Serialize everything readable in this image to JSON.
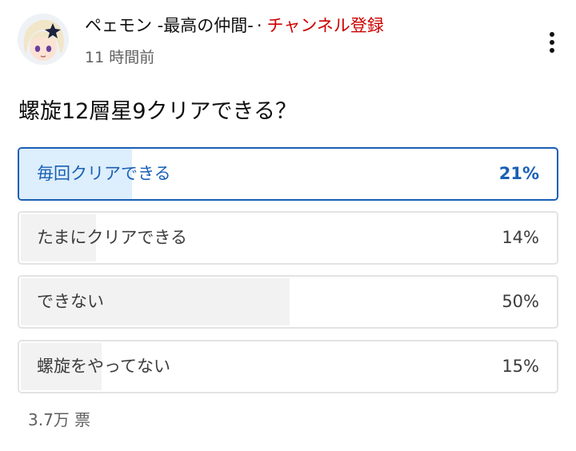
{
  "post": {
    "channel_name": "ペェモン -最高の仲間-",
    "separator": "·",
    "subscribe_label": "チャンネル登録",
    "time_ago": "11 時間前",
    "avatar_icon": "character-avatar",
    "menu_icon": "more-vert-icon"
  },
  "poll": {
    "question": "螺旋12層星9クリアできる？",
    "accent_color": "#1a5fb4",
    "selected_fill_color": "#ddeefc",
    "fill_color": "#f2f2f2",
    "options": [
      {
        "label": "毎回クリアできる",
        "percent_label": "21%",
        "percent": 21,
        "selected": true
      },
      {
        "label": "たまにクリアできる",
        "percent_label": "14%",
        "percent": 14,
        "selected": false
      },
      {
        "label": "できない",
        "percent_label": "50%",
        "percent": 50,
        "selected": false
      },
      {
        "label": "螺旋をやってない",
        "percent_label": "15%",
        "percent": 15,
        "selected": false
      }
    ],
    "total_votes": "3.7万 票"
  }
}
